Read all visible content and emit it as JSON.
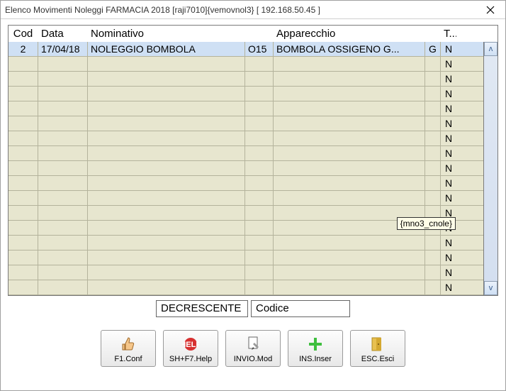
{
  "window": {
    "title": "Elenco Movimenti Noleggi FARMACIA 2018 [raji7010]{vemovnol3} [ 192.168.50.45 ]"
  },
  "columns": {
    "cod": "Cod",
    "data": "Data",
    "nominativo": "Nominativo",
    "apparecchio": "Apparecchio",
    "t": "T..."
  },
  "rows": [
    {
      "cod": "2",
      "data": "17/04/18",
      "nom": "NOLEGGIO BOMBOLA",
      "appcode": "O15",
      "app": "BOMBOLA OSSIGENO G...",
      "g": "G",
      "t": "N"
    },
    {
      "cod": "",
      "data": "",
      "nom": "",
      "appcode": "",
      "app": "",
      "g": "",
      "t": "N"
    },
    {
      "cod": "",
      "data": "",
      "nom": "",
      "appcode": "",
      "app": "",
      "g": "",
      "t": "N"
    },
    {
      "cod": "",
      "data": "",
      "nom": "",
      "appcode": "",
      "app": "",
      "g": "",
      "t": "N"
    },
    {
      "cod": "",
      "data": "",
      "nom": "",
      "appcode": "",
      "app": "",
      "g": "",
      "t": "N"
    },
    {
      "cod": "",
      "data": "",
      "nom": "",
      "appcode": "",
      "app": "",
      "g": "",
      "t": "N"
    },
    {
      "cod": "",
      "data": "",
      "nom": "",
      "appcode": "",
      "app": "",
      "g": "",
      "t": "N"
    },
    {
      "cod": "",
      "data": "",
      "nom": "",
      "appcode": "",
      "app": "",
      "g": "",
      "t": "N"
    },
    {
      "cod": "",
      "data": "",
      "nom": "",
      "appcode": "",
      "app": "",
      "g": "",
      "t": "N"
    },
    {
      "cod": "",
      "data": "",
      "nom": "",
      "appcode": "",
      "app": "",
      "g": "",
      "t": "N"
    },
    {
      "cod": "",
      "data": "",
      "nom": "",
      "appcode": "",
      "app": "",
      "g": "",
      "t": "N"
    },
    {
      "cod": "",
      "data": "",
      "nom": "",
      "appcode": "",
      "app": "",
      "g": "",
      "t": "N"
    },
    {
      "cod": "",
      "data": "",
      "nom": "",
      "appcode": "",
      "app": "",
      "g": "",
      "t": "N"
    },
    {
      "cod": "",
      "data": "",
      "nom": "",
      "appcode": "",
      "app": "",
      "g": "",
      "t": "N"
    },
    {
      "cod": "",
      "data": "",
      "nom": "",
      "appcode": "",
      "app": "",
      "g": "",
      "t": "N"
    },
    {
      "cod": "",
      "data": "",
      "nom": "",
      "appcode": "",
      "app": "",
      "g": "",
      "t": "N"
    },
    {
      "cod": "",
      "data": "",
      "nom": "",
      "appcode": "",
      "app": "",
      "g": "",
      "t": "N"
    }
  ],
  "tooltip": "{mno3_cnole}",
  "filter": {
    "order": "DECRESCENTE",
    "field": "Codice"
  },
  "buttons": {
    "conf": "F1.Conf",
    "help": "SH+F7.Help",
    "mod": "INVIO.Mod",
    "inser": "INS.Inser",
    "esci": "ESC.Esci"
  },
  "scroll": {
    "up": "ʌ",
    "down": "v"
  }
}
